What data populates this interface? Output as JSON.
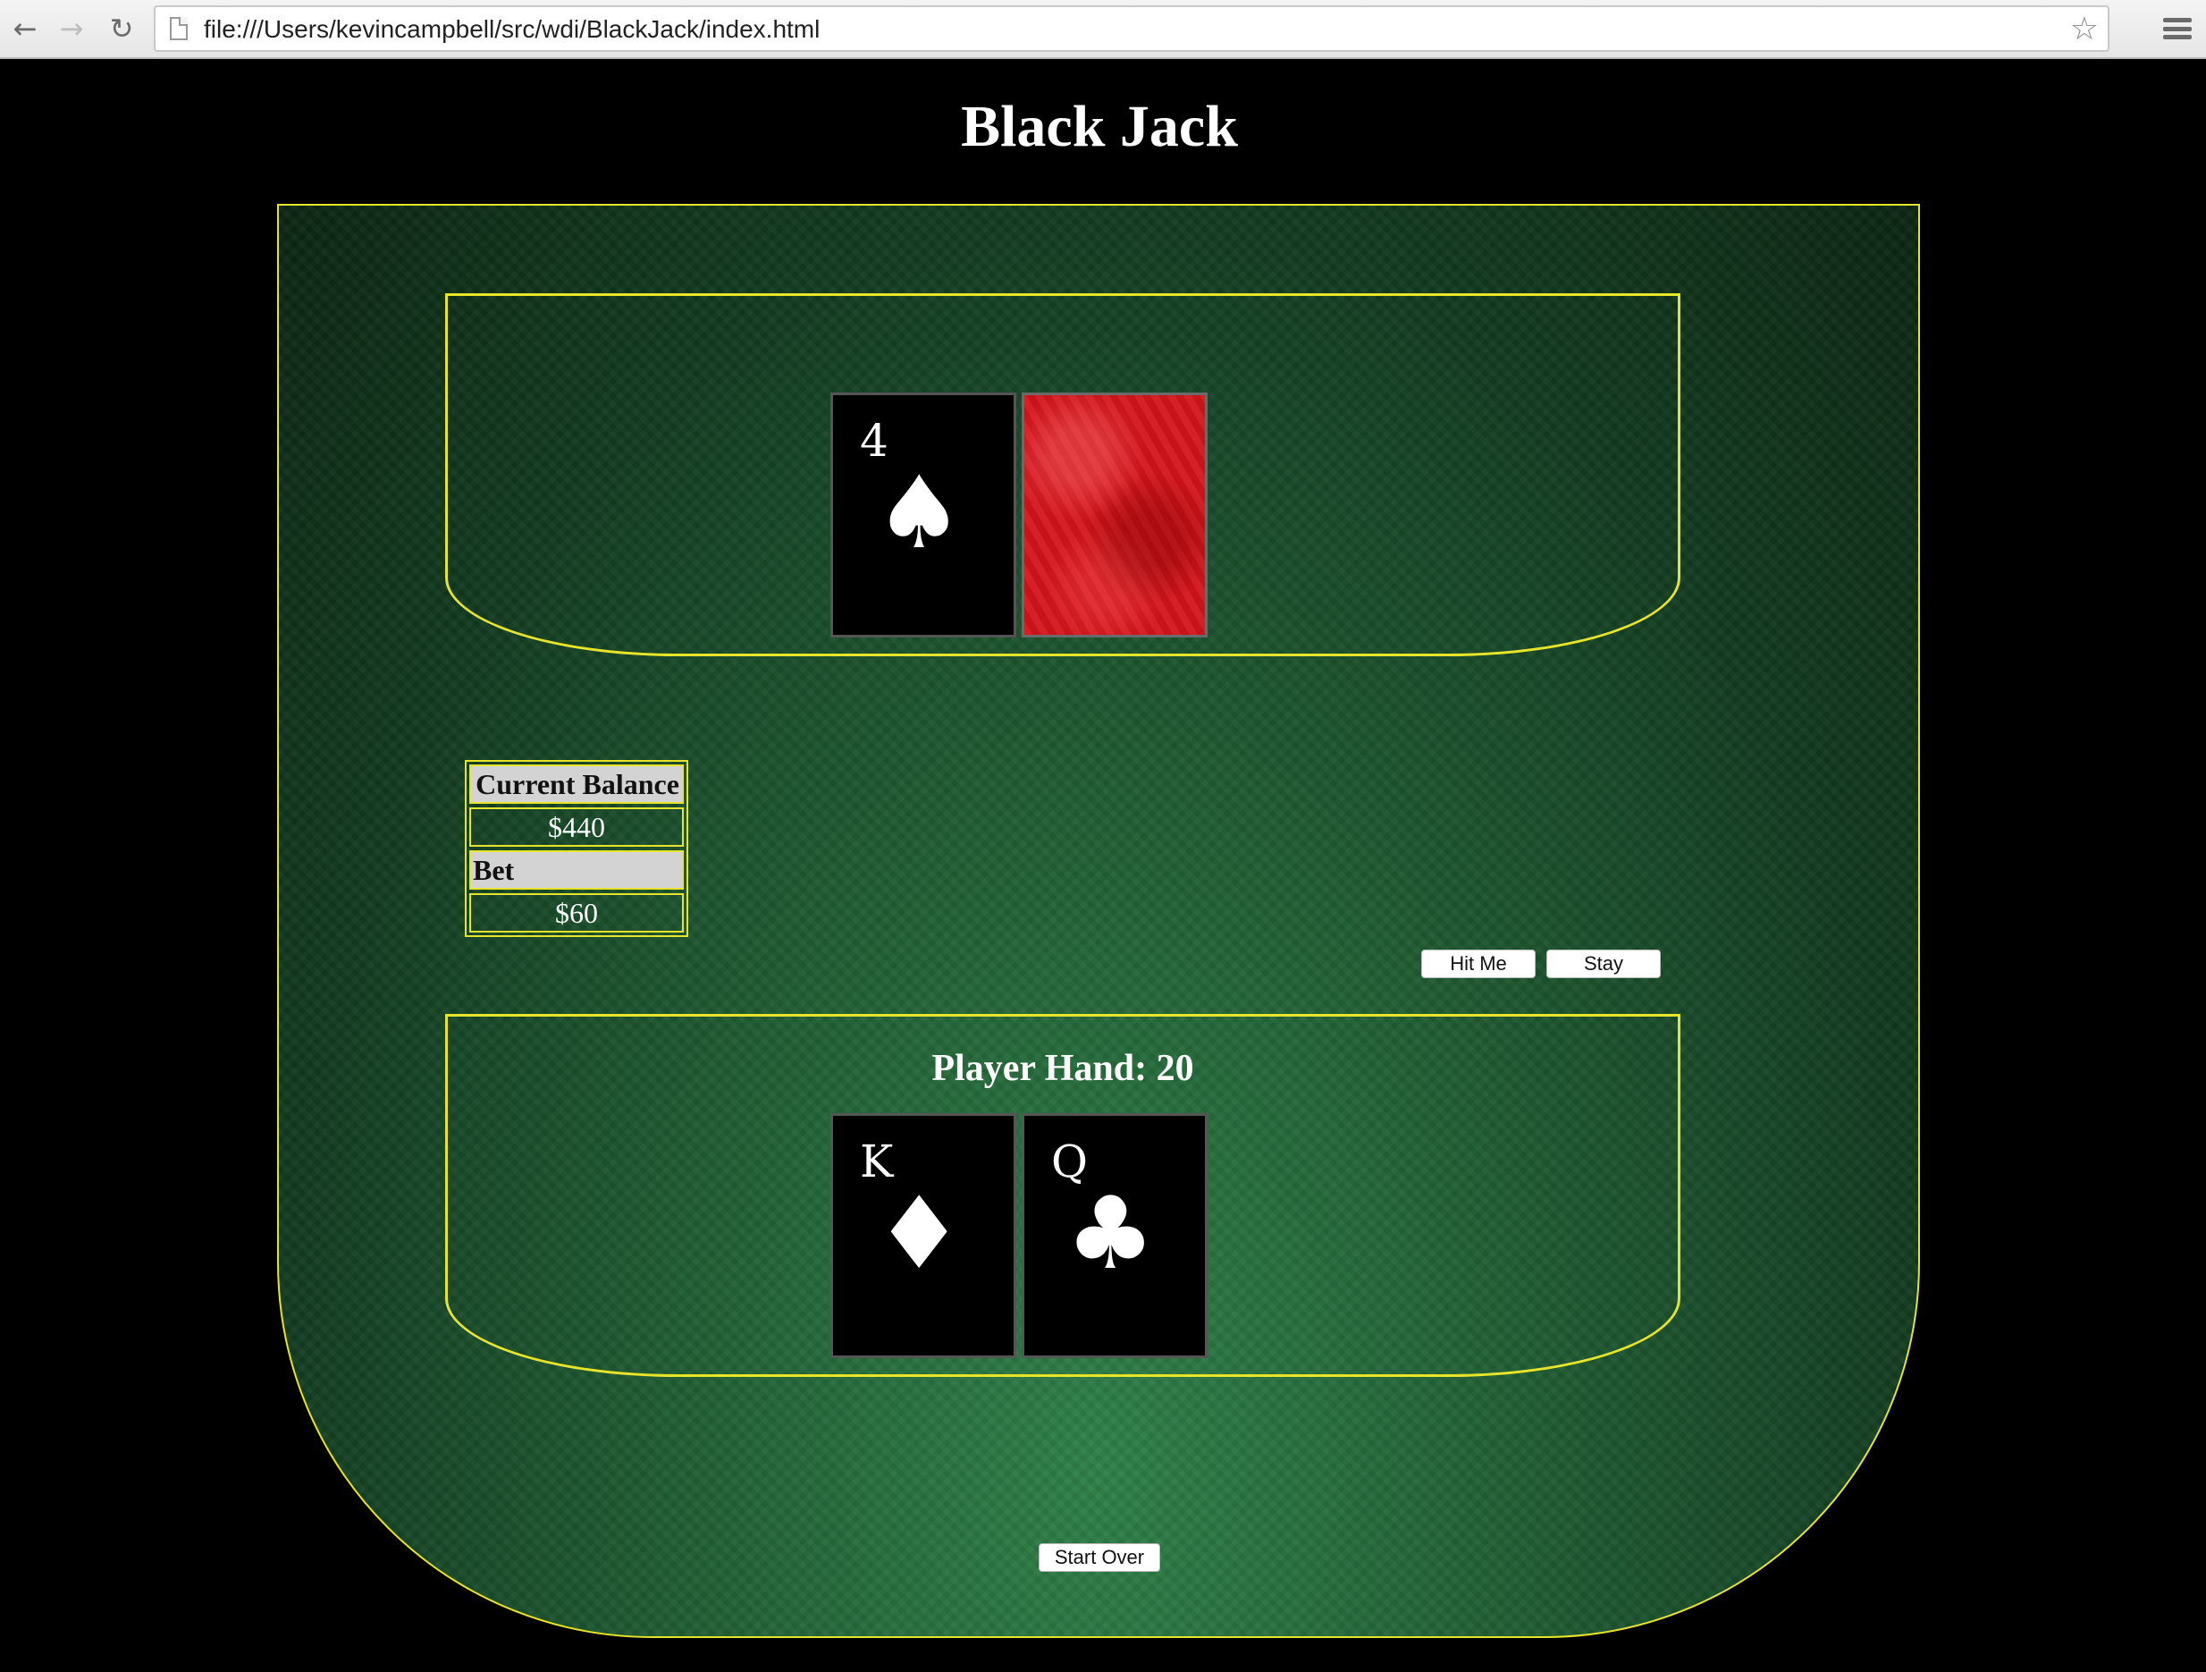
{
  "browser": {
    "url": "file:///Users/kevincampbell/src/wdi/BlackJack/index.html"
  },
  "page": {
    "title": "Black Jack"
  },
  "dealer": {
    "cards": [
      {
        "rank": "4",
        "suit": "♠"
      },
      {
        "face_down": true
      }
    ]
  },
  "balance": {
    "current_label": "Current Balance",
    "current_value": "$440",
    "bet_label": "Bet",
    "bet_value": "$60"
  },
  "controls": {
    "hit_label": "Hit Me",
    "stay_label": "Stay",
    "start_over_label": "Start Over"
  },
  "player": {
    "heading": "Player Hand: 20",
    "cards": [
      {
        "rank": "K",
        "suit": "♦"
      },
      {
        "rank": "Q",
        "suit": "♣"
      }
    ]
  },
  "icons": {
    "back": "back-arrow-icon",
    "forward": "forward-arrow-icon",
    "reload": "reload-icon",
    "page": "page-icon",
    "bookmark": "star-icon",
    "menu": "menu-icon"
  },
  "colors": {
    "felt_border": "#e8e42a",
    "card_back": "#d4141b"
  }
}
